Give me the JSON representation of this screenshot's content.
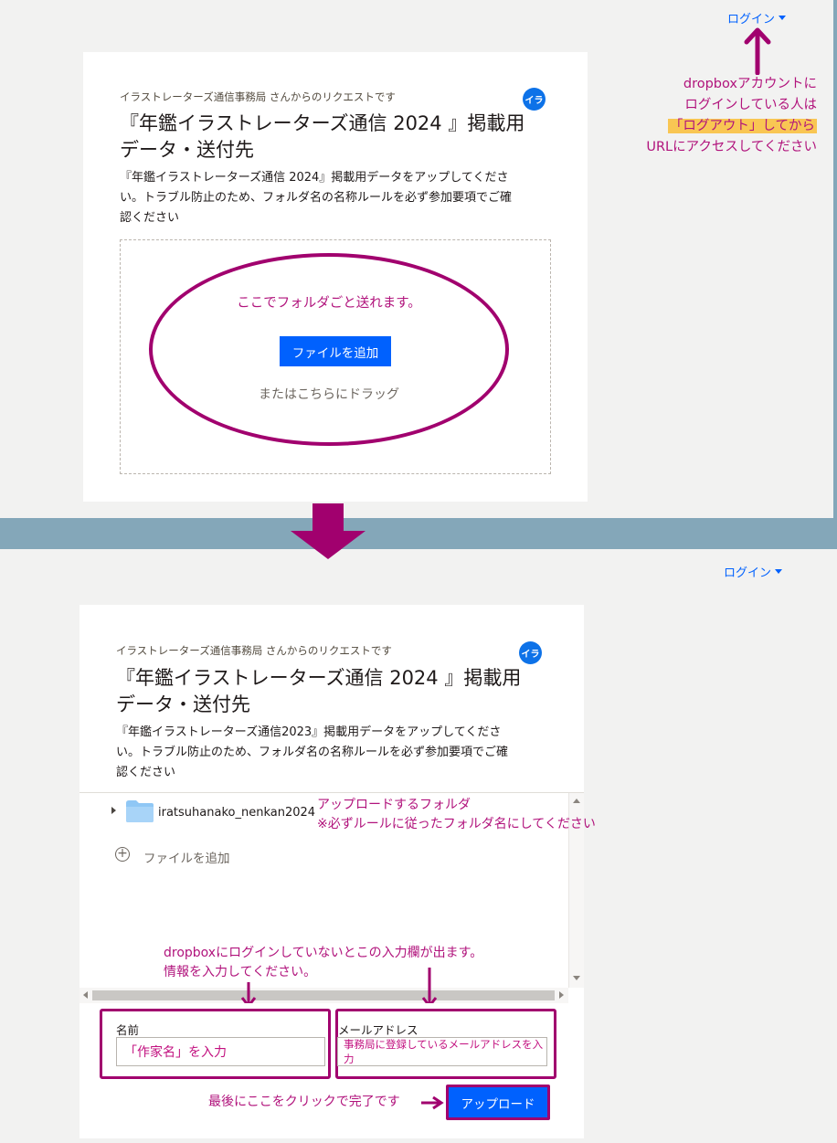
{
  "top": {
    "login_label": "ログイン",
    "note_lines": [
      "dropboxアカウントに",
      "ログインしている人は",
      "「ログアウト」してから",
      "URLにアクセスしてください"
    ],
    "request_from": "イラストレーターズ通信事務局 さんからのリクエストです",
    "avatar": "イラ",
    "title_line1": "『年鑑イラストレーターズ通信 2024 』掲載用",
    "title_line2": "データ・送付先",
    "desc_line1": "『年鑑イラストレーターズ通信 2024』掲載用データをアップしてくださ",
    "desc_line2": "い。トラブル防止のため、フォルダ名の名称ルールを必ず参加要項でご確",
    "desc_line3": "認ください",
    "folder_note": "ここでフォルダごと送れます。",
    "add_file_button": "ファイルを追加",
    "drag_text": "またはこちらにドラッグ"
  },
  "bottom": {
    "login_label": "ログイン",
    "request_from": "イラストレーターズ通信事務局 さんからのリクエストです",
    "avatar": "イラ",
    "title_line1": "『年鑑イラストレーターズ通信 2024 』掲載用",
    "title_line2": "データ・送付先",
    "desc_line1": "『年鑑イラストレーターズ通信2023』掲載用データをアップしてくださ",
    "desc_line2": "い。トラブル防止のため、フォルダ名の名称ルールを必ず参加要項でご確",
    "desc_line3": "認ください",
    "folder_name": "iratsuhanako_nenkan2024",
    "folder_note_line1": "アップロードするフォルダ",
    "folder_note_line2": "※必ずルールに従ったフォルダ名にしてください",
    "add_file_label": "ファイルを追加",
    "login_note_line1": "dropboxにログインしていないとこの入力欄が出ます。",
    "login_note_line2": "情報を入力してください。",
    "name_label": "名前",
    "name_value": "「作家名」を入力",
    "email_label": "メールアドレス",
    "email_value": "事務局に登録しているメールアドレスを入力",
    "final_note": "最後にここをクリックで完了です",
    "upload_button": "アップロード"
  },
  "colors": {
    "accent": "#0061fe",
    "annotation": "#b1137c",
    "highlight": "#f9c653",
    "divider": "#84a7b9"
  }
}
